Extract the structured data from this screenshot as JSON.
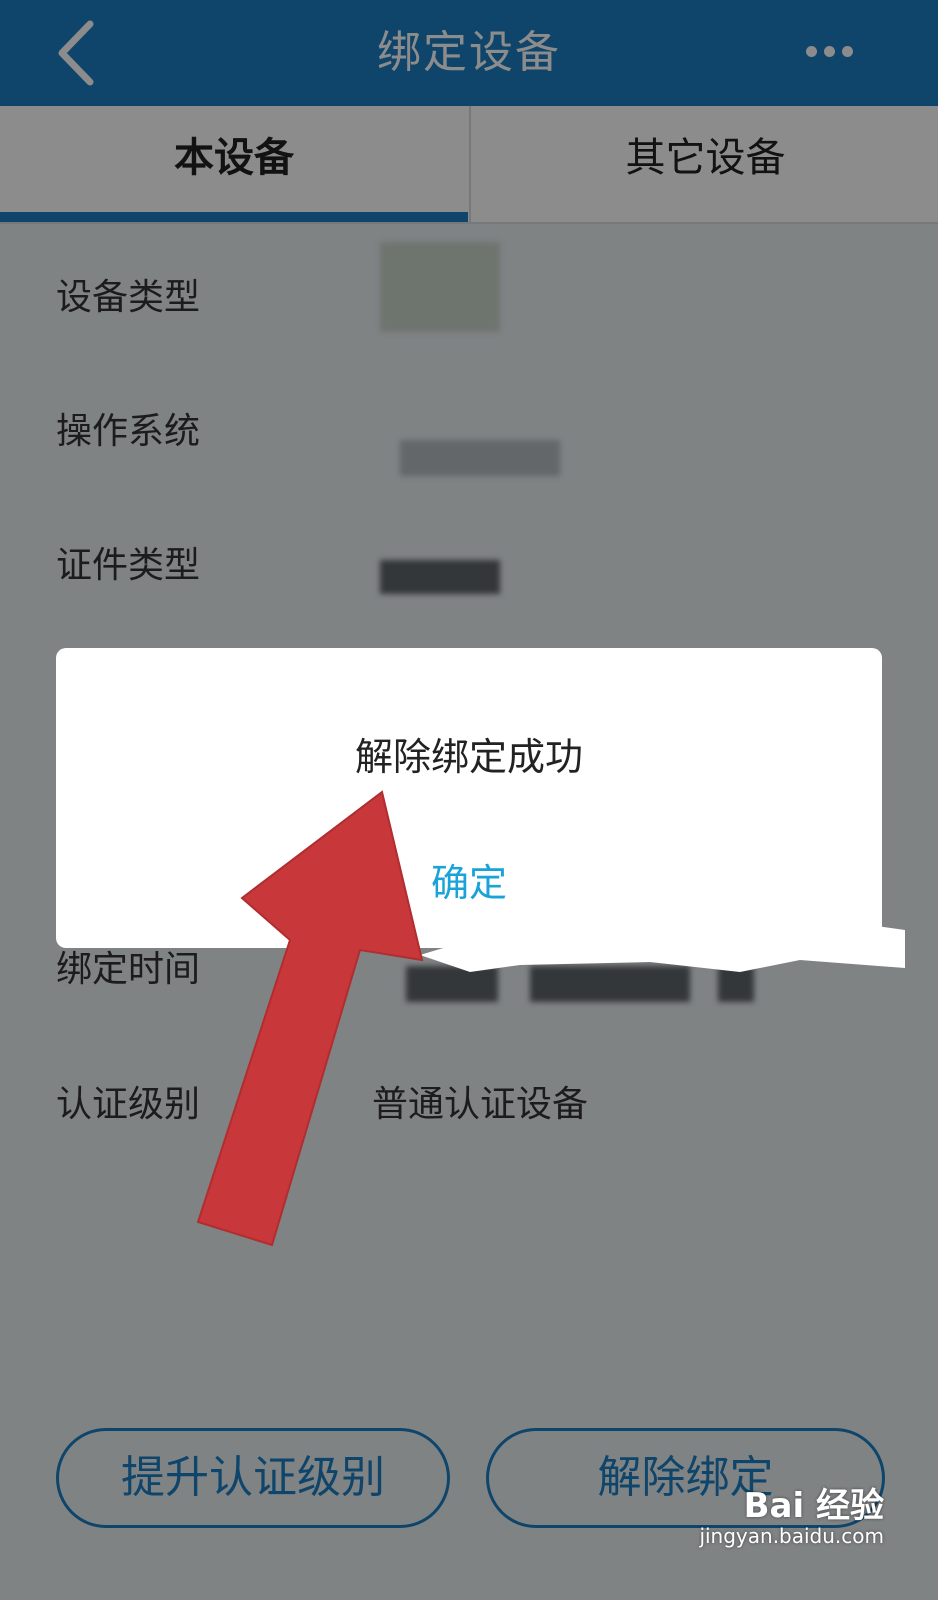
{
  "header": {
    "title": "绑定设备",
    "back_icon": "chevron-left-icon",
    "more_icon": "more-dots-icon",
    "bg_color": "#1d7ec2"
  },
  "tabs": [
    {
      "label": "本设备",
      "active": true
    },
    {
      "label": "其它设备",
      "active": false
    }
  ],
  "fields": [
    {
      "label": "设备类型",
      "value": ""
    },
    {
      "label": "操作系统",
      "value": ""
    },
    {
      "label": "证件类型",
      "value": ""
    },
    {
      "label": "绑定时间",
      "value": ""
    },
    {
      "label": "认证级别",
      "value": "普通认证设备"
    }
  ],
  "buttons": {
    "upgrade": "提升认证级别",
    "unbind": "解除绑定"
  },
  "dialog": {
    "message": "解除绑定成功",
    "confirm": "确定"
  },
  "watermark": {
    "brand": "Bai 经验",
    "url": "jingyan.baidu.com"
  },
  "accent_color": "#1d7ec2",
  "annotation_arrow_color": "#c8373a"
}
